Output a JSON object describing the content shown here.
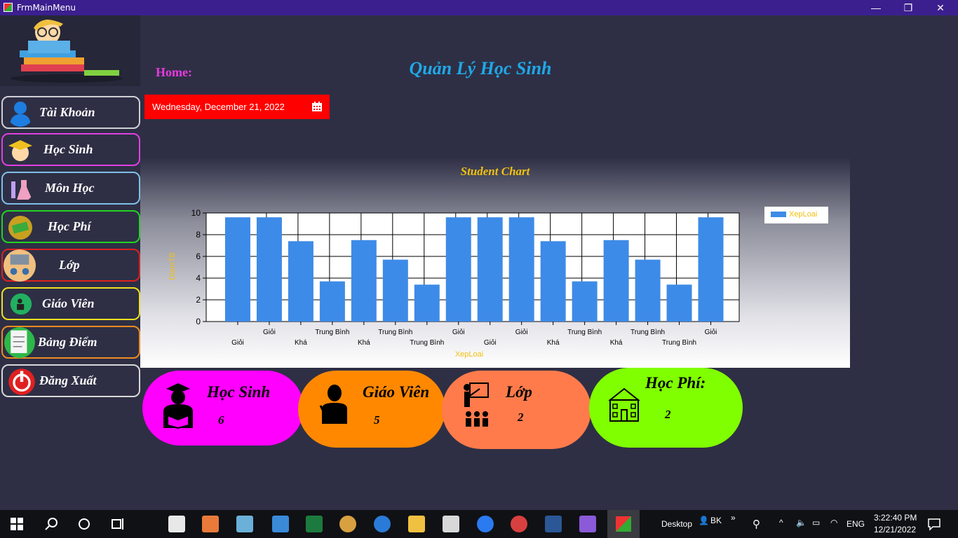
{
  "window": {
    "title": "FrmMainMenu",
    "minimize": "—",
    "restore": "❐",
    "close": "✕"
  },
  "sidebar": {
    "items": [
      {
        "label": "Tài Khoản",
        "color": "#cfcfd6",
        "icon": "user-icon"
      },
      {
        "label": "Học Sinh",
        "color": "#e040e0",
        "icon": "graduate-icon"
      },
      {
        "label": "Môn Học",
        "color": "#7fbfe8",
        "icon": "flask-icon"
      },
      {
        "label": "Học Phí",
        "color": "#22d322",
        "icon": "money-icon"
      },
      {
        "label": "Lớp",
        "color": "#e02020",
        "icon": "classroom-icon"
      },
      {
        "label": "Giáo Viên",
        "color": "#f0e020",
        "icon": "teacher-icon"
      },
      {
        "label": "Bảng Điểm",
        "color": "#f08c20",
        "icon": "report-icon"
      },
      {
        "label": "Đăng Xuất",
        "color": "#d8d8d8",
        "icon": "power-icon"
      }
    ]
  },
  "header": {
    "home": "Home:",
    "title": "Quản Lý Học Sinh"
  },
  "date_picker": {
    "value": "Wednesday, December 21, 2022",
    "icon": "calendar-icon"
  },
  "chart_data": {
    "type": "bar",
    "title": "Student Chart",
    "xlabel": "XepLoai",
    "ylabel": "DiemTB",
    "ylim": [
      0,
      10
    ],
    "yticks": [
      "0",
      "2",
      "4",
      "6",
      "8",
      "10"
    ],
    "categories": [
      "Giỏi",
      "Giỏi",
      "Khá",
      "Trung Bình",
      "Khá",
      "Trung Bình",
      "Trung Bình",
      "Giỏi",
      "Giỏi",
      "Giỏi",
      "Khá",
      "Trung Bình",
      "Khá",
      "Trung Bình",
      "Trung Bình",
      "Giỏi"
    ],
    "series": [
      {
        "name": "XepLoai",
        "color": "#3d8be8",
        "values": [
          9.6,
          9.6,
          7.4,
          3.7,
          7.5,
          5.7,
          3.4,
          9.6,
          9.6,
          9.6,
          7.4,
          3.7,
          7.5,
          5.7,
          3.4,
          9.6
        ]
      }
    ],
    "grid": true,
    "legend": "top-right"
  },
  "cards": [
    {
      "title": "Học Sinh",
      "value": "6",
      "color": "#ff00ff",
      "icon": "student-reading-icon"
    },
    {
      "title": "Giáo Viên",
      "value": "5",
      "color": "#ff8800",
      "icon": "teacher-icon"
    },
    {
      "title": "Lớp",
      "value": "2",
      "color": "#ff7b4c",
      "icon": "classroom-icon"
    },
    {
      "title": "Học Phí:",
      "value": "2",
      "color": "#80ff00",
      "icon": "school-building-icon"
    }
  ],
  "taskbar": {
    "desktop": "Desktop",
    "user": "BK",
    "lang": "ENG",
    "time": "3:22:40 PM",
    "date": "12/21/2022"
  }
}
